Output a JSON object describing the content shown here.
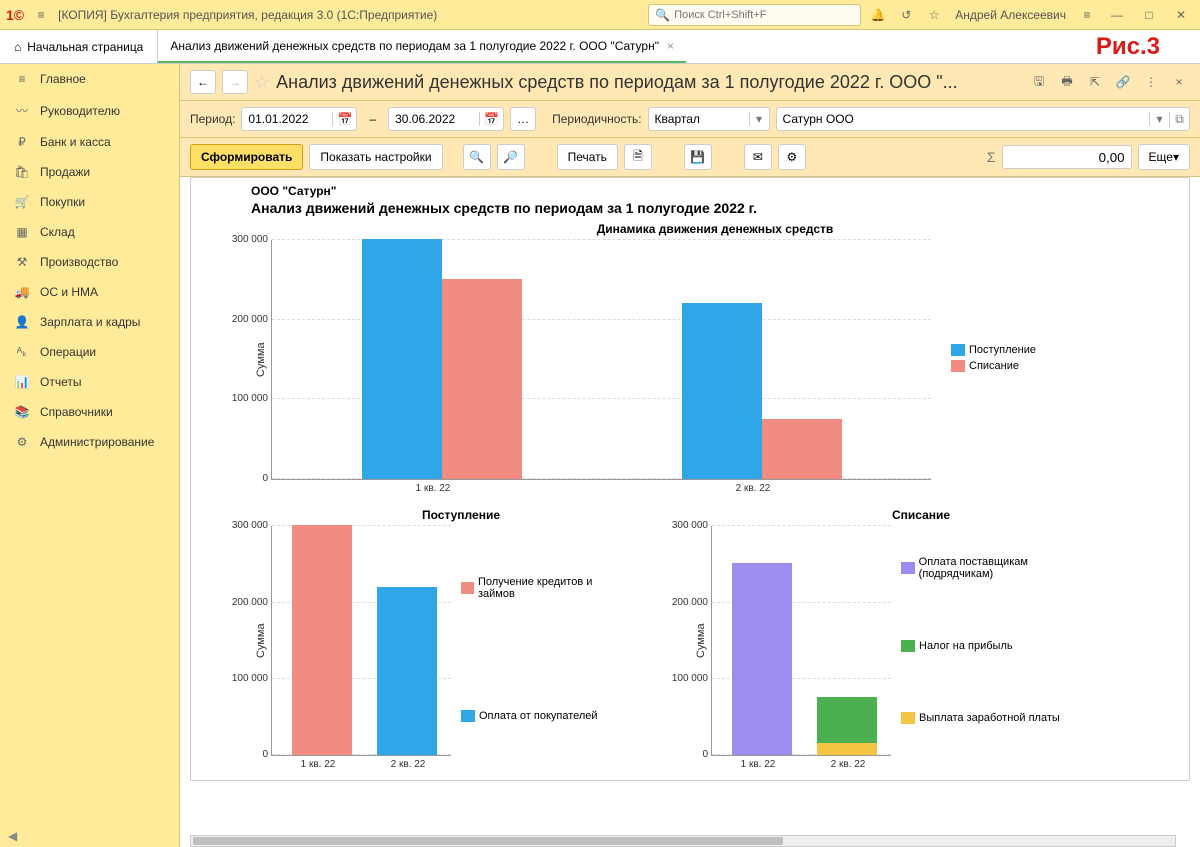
{
  "titlebar": {
    "title": "[КОПИЯ] Бухгалтерия предприятия, редакция 3.0  (1С:Предприятие)",
    "search_placeholder": "Поиск Ctrl+Shift+F",
    "user": "Андрей Алексеевич"
  },
  "tabs": {
    "home": "Начальная страница",
    "active": "Анализ движений денежных средств по периодам за 1 полугодие 2022 г. ООО \"Сатурн\"",
    "fig_label": "Рис.3"
  },
  "sidebar": {
    "items": [
      {
        "icon": "≡",
        "label": "Главное"
      },
      {
        "icon": "〰",
        "label": "Руководителю"
      },
      {
        "icon": "₽",
        "label": "Банк и касса"
      },
      {
        "icon": "🛍",
        "label": "Продажи"
      },
      {
        "icon": "🛒",
        "label": "Покупки"
      },
      {
        "icon": "▦",
        "label": "Склад"
      },
      {
        "icon": "⚒",
        "label": "Производство"
      },
      {
        "icon": "🚚",
        "label": "ОС и НМА"
      },
      {
        "icon": "👤",
        "label": "Зарплата и кадры"
      },
      {
        "icon": "ᴬₖ",
        "label": "Операции"
      },
      {
        "icon": "📊",
        "label": "Отчеты"
      },
      {
        "icon": "📚",
        "label": "Справочники"
      },
      {
        "icon": "⚙",
        "label": "Администрирование"
      }
    ]
  },
  "doc": {
    "title": "Анализ движений денежных средств по периодам за 1 полугодие 2022 г. ООО \"..."
  },
  "filters": {
    "period_label": "Период:",
    "date_from": "01.01.2022",
    "date_to": "30.06.2022",
    "periodicity_label": "Периодичность:",
    "periodicity_value": "Квартал",
    "org_value": "Сатурн ООО"
  },
  "toolbar": {
    "form": "Сформировать",
    "show_settings": "Показать настройки",
    "print": "Печать",
    "more": "Еще",
    "sum_value": "0,00"
  },
  "report": {
    "org": "ООО \"Сатурн\"",
    "title": "Анализ движений денежных средств по периодам за 1 полугодие 2022 г.",
    "chart1_title": "Динамика движения денежных средств",
    "ylabel": "Сумма",
    "chart2_title": "Поступление",
    "chart3_title": "Списание",
    "legend": {
      "in": "Поступление",
      "out": "Списание",
      "credits": "Получение кредитов и займов",
      "buyers": "Оплата от покупателей",
      "suppliers": "Оплата поставщикам (подрядчикам)",
      "tax": "Налог на прибыль",
      "salary": "Выплата заработной платы"
    },
    "xcat": [
      "1 кв. 22",
      "2 кв. 22"
    ]
  },
  "chart_data": [
    {
      "type": "bar",
      "title": "Динамика движения денежных средств",
      "categories": [
        "1 кв. 22",
        "2 кв. 22"
      ],
      "series": [
        {
          "name": "Поступление",
          "values": [
            300000,
            220000
          ]
        },
        {
          "name": "Списание",
          "values": [
            250000,
            75000
          ]
        }
      ],
      "ylabel": "Сумма",
      "ylim": [
        0,
        300000
      ]
    },
    {
      "type": "bar",
      "title": "Поступление",
      "categories": [
        "1 кв. 22",
        "2 кв. 22"
      ],
      "series": [
        {
          "name": "Получение кредитов и займов",
          "values": [
            300000,
            0
          ]
        },
        {
          "name": "Оплата от покупателей",
          "values": [
            0,
            220000
          ]
        }
      ],
      "ylabel": "Сумма",
      "ylim": [
        0,
        300000
      ]
    },
    {
      "type": "stacked-bar",
      "title": "Списание",
      "categories": [
        "1 кв. 22",
        "2 кв. 22"
      ],
      "series": [
        {
          "name": "Оплата поставщикам (подрядчикам)",
          "values": [
            250000,
            0
          ]
        },
        {
          "name": "Налог на прибыль",
          "values": [
            0,
            60000
          ]
        },
        {
          "name": "Выплата заработной платы",
          "values": [
            0,
            15000
          ]
        }
      ],
      "ylabel": "Сумма",
      "ylim": [
        0,
        300000
      ]
    }
  ]
}
